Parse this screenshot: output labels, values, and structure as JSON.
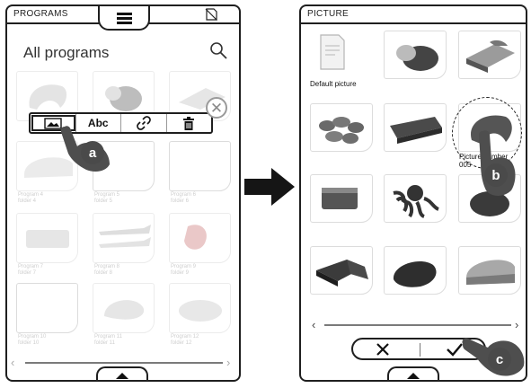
{
  "left_screen": {
    "header": {
      "title": "PROGRAMS"
    },
    "page_title": "All programs",
    "toolbar": {
      "items": [
        {
          "icon": "image-icon"
        },
        {
          "label": "Abc"
        },
        {
          "icon": "link-icon"
        },
        {
          "icon": "trash-icon"
        }
      ]
    },
    "tile_labels": [
      "Program 4\nfolder 4",
      "Program 5\nfolder 5",
      "Program 6\nfolder 6",
      "Program 7\nfolder 7",
      "Program 8\nfolder 8",
      "Program 9\nfolder 9",
      "Program 10\nfolder 10",
      "Program 11\nfolder 11",
      "Program 12\nfolder 12"
    ],
    "callout": "a"
  },
  "right_screen": {
    "header": {
      "title": "PICTURE"
    },
    "default_picture_label": "Default picture",
    "highlighted_label": "Picture number\n005",
    "callout_b": "b",
    "callout_c": "c"
  },
  "colors": {
    "outline": "#1f1f1f",
    "faded": "#d6d6d6",
    "callout": "#4a4a4a"
  }
}
